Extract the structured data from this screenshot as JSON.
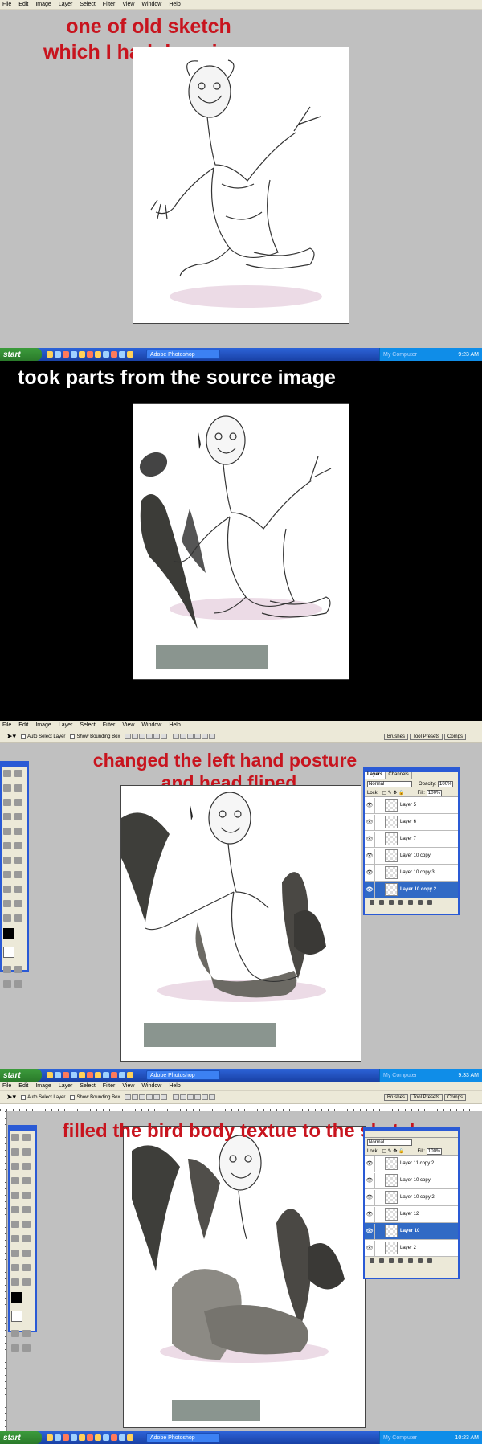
{
  "menu": [
    "File",
    "Edit",
    "Image",
    "Layer",
    "Select",
    "Filter",
    "View",
    "Window",
    "Help"
  ],
  "captions": {
    "p1_line1": "one of old sketch",
    "p1_line2": "which I had done in ps",
    "p2": "took parts from the source image",
    "p3_line1": "changed the left hand posture",
    "p3_line2": "and head fliped",
    "p4": "filled the bird body textue to the sketch"
  },
  "taskbar": {
    "start": "start",
    "app": "Adobe Photoshop",
    "my_computer": "My Computer",
    "time1": "9:23 AM",
    "time2": "9:33 AM",
    "time3": "10:23 AM"
  },
  "options": {
    "auto_select": "Auto Select Layer",
    "bounding": "Show Bounding Box",
    "tabs": [
      "Brushes",
      "Tool Presets",
      "Comps"
    ]
  },
  "layers1": {
    "tabs": [
      "Layers",
      "Channels"
    ],
    "mode": "Normal",
    "opacity_label": "Opacity:",
    "opacity": "100%",
    "lock_label": "Lock:",
    "fill_label": "Fill:",
    "fill": "100%",
    "rows": [
      "Layer 5",
      "Layer 6",
      "Layer 7",
      "Layer 10 copy",
      "Layer 10 copy 3",
      "Layer 10 copy 2"
    ]
  },
  "layers2": {
    "mode": "Normal",
    "fill_label": "Fill:",
    "fill": "100%",
    "lock_label": "Lock:",
    "rows": [
      "Layer 11 copy 2",
      "Layer 10 copy",
      "Layer 10 copy 2",
      "Layer 12",
      "Layer 10",
      "Layer 2"
    ]
  }
}
